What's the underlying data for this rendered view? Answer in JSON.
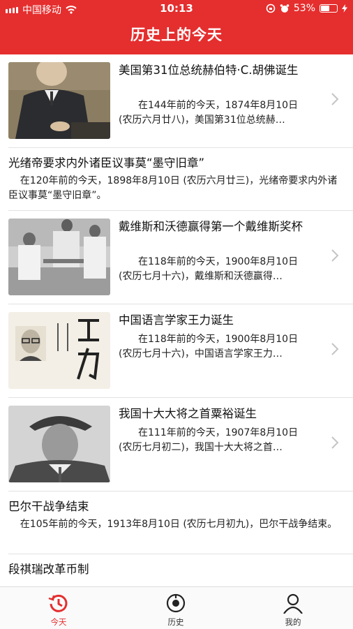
{
  "status": {
    "carrier": "中国移动",
    "time": "10:13",
    "battery": "53%"
  },
  "header": {
    "title": "历史上的今天"
  },
  "items": [
    {
      "title": "美国第31位总统赫伯特·C.胡佛诞生",
      "desc": "在144年前的今天，1874年8月10日 (农历六月廿八)，美国第31位总统赫…",
      "thumb": "portrait-photo"
    },
    {
      "title": "光绪帝要求内外诸臣议事莫“墨守旧章”",
      "desc": "在120年前的今天，1898年8月10日 (农历六月廿三)，光绪帝要求内外诸臣议事莫“墨守旧章”。"
    },
    {
      "title": "戴维斯和沃德赢得第一个戴维斯奖杯",
      "desc": "在118年前的今天，1900年8月10日 (农历七月十六)，戴维斯和沃德赢得…",
      "thumb": "tennis-photo"
    },
    {
      "title": "中国语言学家王力诞生",
      "desc": "在118年前的今天，1900年8月10日 (农历七月十六)，中国语言学家王力…",
      "thumb": "book-cover-photo"
    },
    {
      "title": "我国十大大将之首粟裕诞生",
      "desc": "在111年前的今天，1907年8月10日 (农历七月初二)，我国十大大将之首…",
      "thumb": "general-photo"
    },
    {
      "title": "巴尔干战争结束",
      "desc": "在105年前的今天，1913年8月10日 (农历七月初九)，巴尔干战争结束。"
    },
    {
      "title": "段祺瑞改革币制"
    }
  ],
  "tabs": [
    {
      "label": "今天",
      "icon": "history-clock-icon",
      "active": true
    },
    {
      "label": "历史",
      "icon": "history-disc-icon",
      "active": false
    },
    {
      "label": "我的",
      "icon": "user-icon",
      "active": false
    }
  ],
  "colors": {
    "accent": "#e52e2e"
  }
}
